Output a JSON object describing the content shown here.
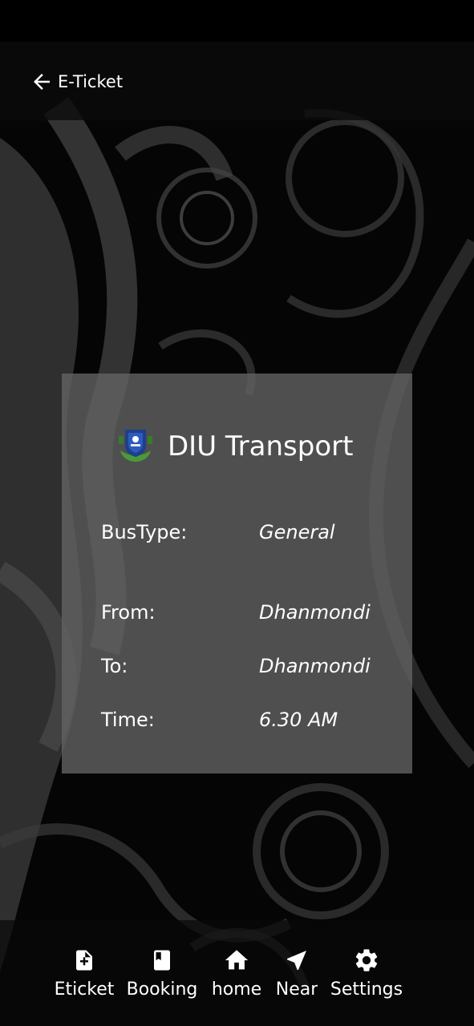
{
  "header": {
    "title": "E-Ticket"
  },
  "ticket": {
    "title": "DIU Transport",
    "rows": [
      {
        "label": "BusType:",
        "value": "General"
      },
      {
        "label": "From:",
        "value": "Dhanmondi"
      },
      {
        "label": "To:",
        "value": "Dhanmondi"
      },
      {
        "label": "Time:",
        "value": "6.30 AM"
      }
    ]
  },
  "nav": {
    "items": [
      {
        "label": "Eticket",
        "icon": "file-plus-icon"
      },
      {
        "label": "Booking",
        "icon": "book-icon"
      },
      {
        "label": "home",
        "icon": "home-icon"
      },
      {
        "label": "Near",
        "icon": "navigation-arrow-icon"
      },
      {
        "label": "Settings",
        "icon": "gear-icon"
      }
    ]
  },
  "colors": {
    "card": "#646464",
    "background": "#000000",
    "text": "#ffffff"
  }
}
